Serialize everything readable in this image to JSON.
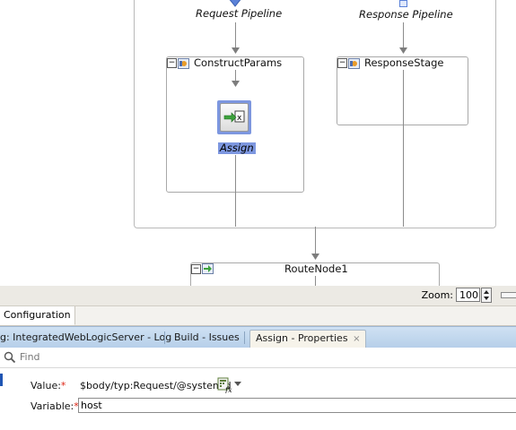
{
  "canvas": {
    "request_pipeline_label": "Request Pipeline",
    "response_pipeline_label": "Response Pipeline",
    "construct_stage_title": "ConstructParams",
    "response_stage_title": "ResponseStage",
    "assign_action_label": "Assign",
    "route_node_title": "RouteNode1"
  },
  "zoom": {
    "label": "Zoom:",
    "value": "100"
  },
  "config_tab": {
    "label": "Configuration"
  },
  "log_tabs": {
    "server_log": "g: IntegratedWebLogicServer - Log",
    "build_issues": "Build - Issues",
    "assign_properties": "Assign - Properties",
    "close_symbol": "×"
  },
  "find": {
    "placeholder": "Find"
  },
  "properties": {
    "value_label": "Value:",
    "value": "$body/typ:Request/@systemid",
    "variable_label": "Variable:",
    "variable": "host",
    "required_mark": "*"
  },
  "colors": {
    "selection_highlight": "#7d97e0",
    "tab_strip": "#c4d8ef",
    "required": "#d21111"
  },
  "icons": [
    "diamond-icon",
    "collapse-icon",
    "stage-icon",
    "assign-icon",
    "route-icon",
    "expression-editor-icon",
    "dropdown-arrow-icon",
    "find-icon",
    "spinner-icon"
  ]
}
